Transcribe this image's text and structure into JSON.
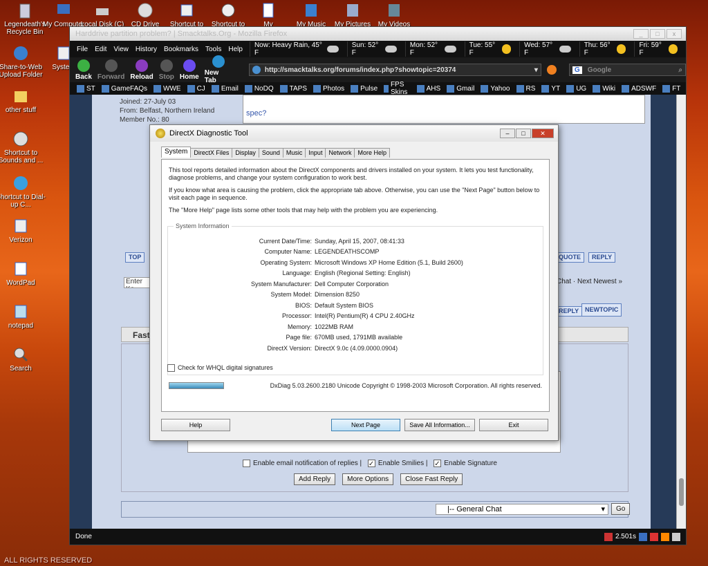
{
  "desktop": {
    "icons": [
      {
        "label": "Legendeath's Recycle Bin"
      },
      {
        "label": "Share-to-Web Upload Folder"
      },
      {
        "label": "other stuff"
      },
      {
        "label": "Shortcut to Sounds and ..."
      },
      {
        "label": "Shortcut to Dial-up C..."
      },
      {
        "label": "Verizon"
      },
      {
        "label": "WordPad"
      },
      {
        "label": "notepad"
      },
      {
        "label": "Search"
      }
    ],
    "top_icons": [
      {
        "label": "My Computer"
      },
      {
        "label": "Local Disk (C)"
      },
      {
        "label": "CD Drive"
      },
      {
        "label": "Shortcut to"
      },
      {
        "label": "Shortcut to"
      },
      {
        "label": "My"
      },
      {
        "label": "My Music"
      },
      {
        "label": "My Pictures"
      },
      {
        "label": "My Videos"
      },
      {
        "label": "System"
      }
    ],
    "footer": "ALL RIGHTS RESERVED"
  },
  "browser": {
    "title": "Harddrive partition problem? | Smacktalks.Org - Mozilla Firefox",
    "menu": [
      "File",
      "Edit",
      "View",
      "History",
      "Bookmarks",
      "Tools",
      "Help"
    ],
    "weather": [
      {
        "label": "Now: Heavy Rain, 45° F"
      },
      {
        "label": "Sun: 52° F"
      },
      {
        "label": "Mon: 52° F"
      },
      {
        "label": "Tue: 55° F"
      },
      {
        "label": "Wed: 57° F"
      },
      {
        "label": "Thu: 56° F"
      },
      {
        "label": "Fri: 59° F"
      }
    ],
    "nav": {
      "back": "Back",
      "forward": "Forward",
      "reload": "Reload",
      "stop": "Stop",
      "home": "Home",
      "new_tab": "New Tab"
    },
    "url": "http://smacktalks.org/forums/index.php?showtopic=20374",
    "search_placeholder": "Google",
    "bookmarks": [
      "ST",
      "GameFAQs",
      "WWE",
      "CJ",
      "Email",
      "NoDQ",
      "TAPS",
      "Photos",
      "Pulse",
      "FPS Skins",
      "AHS",
      "Gmail",
      "Yahoo",
      "RS",
      "YT",
      "UG",
      "Wiki",
      "ADSWF",
      "FT"
    ],
    "status": "Done",
    "status_right": "2.501s"
  },
  "forum": {
    "joined": "Joined: 27-July 03",
    "from": "From: Belfast, Northern Ireland",
    "member_no": "Member No.: 80",
    "post_text": "spec?",
    "top_btn": "TOP",
    "quote_btn": "QUOTE",
    "reply_btn": "REPLY",
    "search_placeholder": "Enter Ke",
    "nav_links": "Chat · Next Newest »",
    "reply_btn2": "REPLY",
    "newtopic_btn": "NEWTOPIC",
    "fast_reply": "Fast R",
    "enable_email": "Enable email notification of replies |",
    "enable_smilies": "Enable Smilies |",
    "enable_signature": "Enable Signature",
    "add_reply": "Add Reply",
    "more_options": "More Options",
    "close_fast_reply": "Close Fast Reply",
    "jump_select": "|-- General Chat",
    "go": "Go"
  },
  "dxdiag": {
    "title": "DirectX Diagnostic Tool",
    "tabs": [
      "System",
      "DirectX Files",
      "Display",
      "Sound",
      "Music",
      "Input",
      "Network",
      "More Help"
    ],
    "para1": "This tool reports detailed information about the DirectX components and drivers installed on your system.  It lets you test functionality, diagnose problems, and change your system configuration to work best.",
    "para2": "If you know what area is causing the problem, click the appropriate tab above.  Otherwise, you can use the \"Next Page\" button below to visit each page in sequence.",
    "para3": "The \"More Help\" page lists some other tools that may help with the problem you are experiencing.",
    "sysinfo_legend": "System Information",
    "rows": [
      {
        "k": "Current Date/Time:",
        "v": "Sunday, April 15, 2007, 08:41:33"
      },
      {
        "k": "Computer Name:",
        "v": "LEGENDEATHSCOMP"
      },
      {
        "k": "Operating System:",
        "v": "Microsoft Windows XP Home Edition (5.1, Build 2600)"
      },
      {
        "k": "Language:",
        "v": "English (Regional Setting: English)"
      },
      {
        "k": "System Manufacturer:",
        "v": "Dell Computer Corporation"
      },
      {
        "k": "System Model:",
        "v": "Dimension 8250"
      },
      {
        "k": "BIOS:",
        "v": "Default System BIOS"
      },
      {
        "k": "Processor:",
        "v": "Intel(R) Pentium(R) 4 CPU 2.40GHz"
      },
      {
        "k": "Memory:",
        "v": "1022MB RAM"
      },
      {
        "k": "Page file:",
        "v": "670MB used, 1791MB available"
      },
      {
        "k": "DirectX Version:",
        "v": "DirectX 9.0c (4.09.0000.0904)"
      }
    ],
    "whql": "Check for WHQL digital signatures",
    "copyright": "DxDiag 5.03.2600.2180 Unicode  Copyright © 1998-2003 Microsoft Corporation.  All rights reserved.",
    "buttons": {
      "help": "Help",
      "next": "Next Page",
      "save": "Save All Information...",
      "exit": "Exit"
    }
  }
}
